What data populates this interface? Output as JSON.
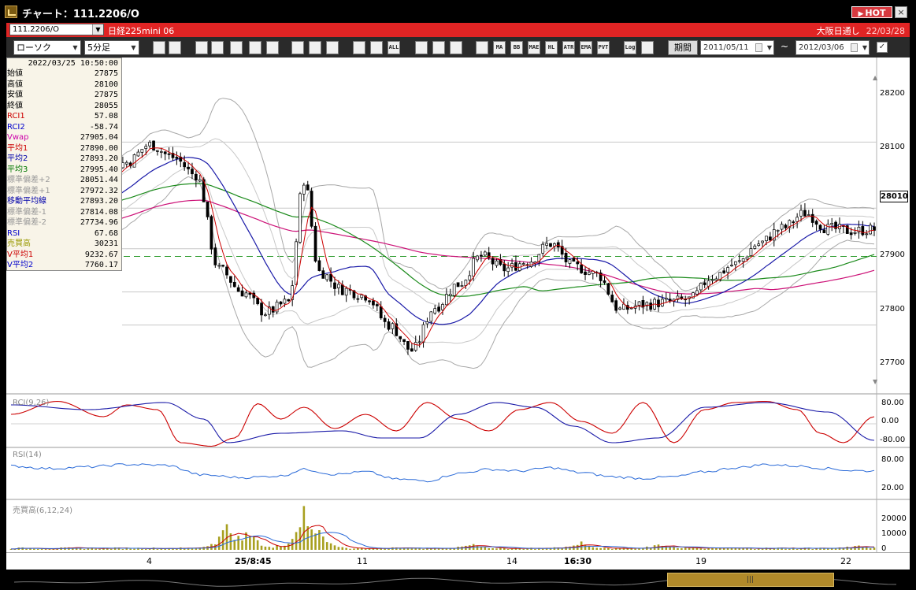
{
  "window": {
    "title": "チャート：111.2206/O",
    "hot_label": "HOT",
    "close_label": "×"
  },
  "symbolbar": {
    "symbol": "111.2206/O",
    "instrument": "日経225mini 06",
    "session": "大阪日通し",
    "date": "22/03/28"
  },
  "toolbar": {
    "chart_type": "ローソク",
    "interval": "5分足",
    "period_label": "期間",
    "date_from": "2011/05/11",
    "date_to": "2012/03/06",
    "tilde": "~",
    "icons": [
      "search-icon",
      "grid-icon",
      "settings-icon",
      "magnify-icon",
      "draw-icon",
      "candle-icon",
      "alert-icon",
      "pen-icon",
      "cursor-icon",
      "arrow-icon",
      "bar-icon",
      "bar2-icon",
      "all-icon",
      "pattern-icon",
      "brush-icon",
      "color-icon",
      "mvg-icon",
      "ma-icon",
      "bb-icon",
      "mae-icon",
      "hl-icon",
      "atr-icon",
      "ema-icon",
      "pvt-icon",
      "log-icon",
      "export-icon"
    ],
    "icon_labels": [
      "",
      "",
      "",
      "",
      "",
      "",
      "",
      "",
      "",
      "",
      "",
      "",
      "ALL",
      "",
      "",
      "",
      "",
      "MA",
      "BB",
      "MAE",
      "HL",
      "ATR",
      "EMA",
      "PVT",
      "Log",
      ""
    ]
  },
  "infobox": {
    "datetime": "2022/03/25  10:50:00",
    "rows": [
      {
        "k": "始値",
        "v": "27875",
        "c": "#000000"
      },
      {
        "k": "高値",
        "v": "28100",
        "c": "#000000"
      },
      {
        "k": "安値",
        "v": "27875",
        "c": "#000000"
      },
      {
        "k": "終値",
        "v": "28055",
        "c": "#000000"
      },
      {
        "k": "RCI1",
        "v": "57.08",
        "c": "#cc0000"
      },
      {
        "k": "RCI2",
        "v": "-58.74",
        "c": "#0000cc"
      },
      {
        "k": "Vwap",
        "v": "27905.04",
        "c": "#cc00aa"
      },
      {
        "k": "平均1",
        "v": "27890.00",
        "c": "#cc0000"
      },
      {
        "k": "平均2",
        "v": "27893.20",
        "c": "#0000aa"
      },
      {
        "k": "平均3",
        "v": "27995.40",
        "c": "#007700"
      },
      {
        "k": "標準偏差+2",
        "v": "28051.44",
        "c": "#999999"
      },
      {
        "k": "標準偏差+1",
        "v": "27972.32",
        "c": "#999999"
      },
      {
        "k": "移動平均線",
        "v": "27893.20",
        "c": "#0000aa"
      },
      {
        "k": "標準偏差-1",
        "v": "27814.08",
        "c": "#999999"
      },
      {
        "k": "標準偏差-2",
        "v": "27734.96",
        "c": "#999999"
      },
      {
        "k": "RSI",
        "v": "67.68",
        "c": "#0000cc"
      },
      {
        "k": "売買高",
        "v": "30231",
        "c": "#999900"
      },
      {
        "k": "V平均1",
        "v": "9232.67",
        "c": "#cc0000"
      },
      {
        "k": "V平均2",
        "v": "7760.17",
        "c": "#0000cc"
      }
    ]
  },
  "price_axis": {
    "labels": [
      "28200",
      "28100",
      "28010",
      "27900",
      "27800",
      "27700"
    ],
    "current": "28010"
  },
  "panels": {
    "rci": {
      "title": "RCI(9,26)",
      "labels": [
        "80.00",
        "0.00",
        "-80.00"
      ]
    },
    "rsi": {
      "title": "RSI(14)",
      "labels": [
        "80.00",
        "20.00"
      ]
    },
    "volume": {
      "title": "売買高(6,12,24)",
      "labels": [
        "20000",
        "10000",
        "0"
      ]
    }
  },
  "xaxis": {
    "labels": [
      {
        "t": "4",
        "b": false
      },
      {
        "t": "25/8:45",
        "b": true
      },
      {
        "t": "11",
        "b": false
      },
      {
        "t": "14",
        "b": false
      },
      {
        "t": "16:30",
        "b": true
      },
      {
        "t": "19",
        "b": false
      },
      {
        "t": "22",
        "b": false
      }
    ]
  },
  "colors": {
    "up": "#ffffff",
    "down": "#000000",
    "ma1": "#cc0000",
    "ma2": "#1a1aa8",
    "ma3": "#1a8a1a",
    "vwap": "#cc1177",
    "band": "#a8a8a8",
    "vol": "#a8a020",
    "accent": "#e02424"
  },
  "chart_data": [
    {
      "type": "candlestick",
      "title": "",
      "ylim": [
        27650,
        28270
      ],
      "anchors": [
        {
          "i": 0,
          "p": 27990
        },
        {
          "i": 10,
          "p": 27985
        },
        {
          "i": 20,
          "p": 28035
        },
        {
          "i": 30,
          "p": 28090
        },
        {
          "i": 36,
          "p": 28125
        },
        {
          "i": 42,
          "p": 28100
        },
        {
          "i": 48,
          "p": 28065
        },
        {
          "i": 54,
          "p": 27880
        },
        {
          "i": 60,
          "p": 27835
        },
        {
          "i": 66,
          "p": 27795
        },
        {
          "i": 72,
          "p": 27815
        },
        {
          "i": 76,
          "p": 28055
        },
        {
          "i": 80,
          "p": 27875
        },
        {
          "i": 86,
          "p": 27840
        },
        {
          "i": 92,
          "p": 27828
        },
        {
          "i": 98,
          "p": 27770
        },
        {
          "i": 104,
          "p": 27720
        },
        {
          "i": 110,
          "p": 27805
        },
        {
          "i": 116,
          "p": 27850
        },
        {
          "i": 122,
          "p": 27905
        },
        {
          "i": 128,
          "p": 27880
        },
        {
          "i": 134,
          "p": 27895
        },
        {
          "i": 140,
          "p": 27930
        },
        {
          "i": 146,
          "p": 27885
        },
        {
          "i": 152,
          "p": 27870
        },
        {
          "i": 158,
          "p": 27800
        },
        {
          "i": 164,
          "p": 27810
        },
        {
          "i": 170,
          "p": 27815
        },
        {
          "i": 176,
          "p": 27820
        },
        {
          "i": 182,
          "p": 27865
        },
        {
          "i": 188,
          "p": 27890
        },
        {
          "i": 194,
          "p": 27930
        },
        {
          "i": 200,
          "p": 27960
        },
        {
          "i": 206,
          "p": 27990
        },
        {
          "i": 212,
          "p": 27960
        },
        {
          "i": 218,
          "p": 27955
        },
        {
          "i": 224,
          "p": 27958
        }
      ],
      "count": 225,
      "last": 28010
    },
    {
      "type": "line",
      "title": "RCI(9,26)",
      "ylim": [
        -100,
        100
      ],
      "series": [
        {
          "name": "RCI1",
          "anchors": [
            [
              0,
              40
            ],
            [
              12,
              95
            ],
            [
              24,
              30
            ],
            [
              30,
              80
            ],
            [
              38,
              60
            ],
            [
              44,
              -80
            ],
            [
              52,
              -95
            ],
            [
              58,
              -60
            ],
            [
              64,
              85
            ],
            [
              70,
              20
            ],
            [
              76,
              70
            ],
            [
              84,
              -20
            ],
            [
              92,
              40
            ],
            [
              100,
              -30
            ],
            [
              108,
              90
            ],
            [
              116,
              20
            ],
            [
              124,
              -30
            ],
            [
              132,
              60
            ],
            [
              140,
              90
            ],
            [
              148,
              10
            ],
            [
              156,
              -40
            ],
            [
              164,
              90
            ],
            [
              172,
              -80
            ],
            [
              180,
              60
            ],
            [
              188,
              90
            ],
            [
              196,
              95
            ],
            [
              204,
              60
            ],
            [
              210,
              -40
            ],
            [
              216,
              -80
            ],
            [
              224,
              30
            ]
          ]
        },
        {
          "name": "RCI2",
          "anchors": [
            [
              0,
              80
            ],
            [
              20,
              60
            ],
            [
              40,
              90
            ],
            [
              50,
              20
            ],
            [
              56,
              -80
            ],
            [
              70,
              -40
            ],
            [
              86,
              -30
            ],
            [
              96,
              -60
            ],
            [
              106,
              -60
            ],
            [
              116,
              40
            ],
            [
              126,
              90
            ],
            [
              136,
              70
            ],
            [
              146,
              -10
            ],
            [
              156,
              -80
            ],
            [
              168,
              -60
            ],
            [
              180,
              70
            ],
            [
              196,
              90
            ],
            [
              212,
              50
            ],
            [
              224,
              -70
            ]
          ]
        }
      ]
    },
    {
      "type": "line",
      "title": "RSI(14)",
      "ylim": [
        0,
        100
      ],
      "series": [
        {
          "name": "RSI",
          "anchors": [
            [
              0,
              66
            ],
            [
              10,
              60
            ],
            [
              20,
              64
            ],
            [
              30,
              70
            ],
            [
              40,
              68
            ],
            [
              50,
              44
            ],
            [
              60,
              38
            ],
            [
              70,
              42
            ],
            [
              76,
              58
            ],
            [
              84,
              46
            ],
            [
              92,
              52
            ],
            [
              100,
              34
            ],
            [
              108,
              30
            ],
            [
              116,
              48
            ],
            [
              124,
              58
            ],
            [
              132,
              54
            ],
            [
              140,
              62
            ],
            [
              148,
              50
            ],
            [
              156,
              40
            ],
            [
              164,
              36
            ],
            [
              172,
              40
            ],
            [
              180,
              52
            ],
            [
              188,
              62
            ],
            [
              196,
              70
            ],
            [
              204,
              66
            ],
            [
              212,
              60
            ],
            [
              218,
              55
            ],
            [
              224,
              54
            ]
          ]
        }
      ]
    },
    {
      "type": "bar",
      "title": "売買高(6,12,24)",
      "ylim": [
        0,
        25000
      ],
      "bursts": [
        {
          "i": 56,
          "v": 17000
        },
        {
          "i": 62,
          "v": 11000
        },
        {
          "i": 76,
          "v": 23000
        },
        {
          "i": 80,
          "v": 9000
        },
        {
          "i": 120,
          "v": 3000
        },
        {
          "i": 148,
          "v": 4000
        },
        {
          "i": 168,
          "v": 2500
        },
        {
          "i": 220,
          "v": 2000
        }
      ]
    }
  ]
}
